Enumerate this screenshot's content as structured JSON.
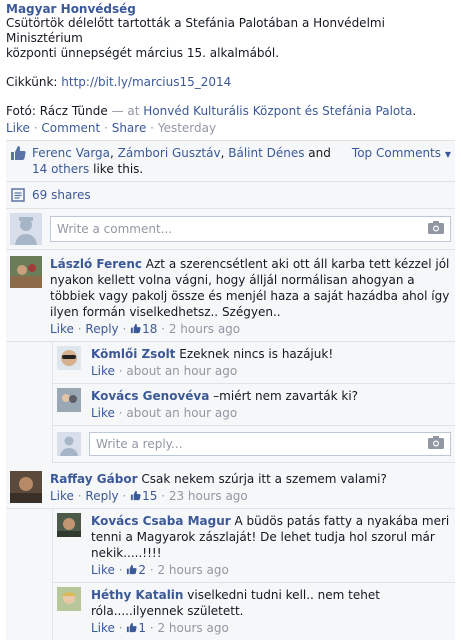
{
  "post": {
    "author": "Magyar Honvédség",
    "line1": "Csütörtök délelőtt tartották a Stefánia Palotában a Honvédelmi Minisztérium",
    "line2": "központi ünnepségét március 15. alkalmából.",
    "cikk_label": "Cikkünk: ",
    "cikk_link": "http://bit.ly/marcius15_2014",
    "foto_label": "Fotó: Rácz Tünde",
    "at_label": " — at ",
    "place": "Honvéd Kulturális Központ és Stefánia Palota",
    "period": ".",
    "like_label": "Like",
    "comment_label": "Comment",
    "share_label": "Share",
    "time": "Yesterday"
  },
  "likes": {
    "names": [
      "Ferenc Varga",
      "Zámbori Gusztáv",
      "Bálint Dénes"
    ],
    "and_text": " and",
    "others": "14 others",
    "suffix": " like this.",
    "top_comments": "Top Comments",
    "shares": "69 shares"
  },
  "composer": {
    "placeholder": "Write a comment...",
    "reply_placeholder": "Write a reply..."
  },
  "comments": [
    {
      "name": "László Ferenc",
      "text": "Azt a szerencsétlent aki ott áll karba tett kézzel jól nyakon kellett volna vágni, hogy álljál normálisan ahogyan a többiek vagy pakolj össze és menjél haza a saját hazádba ahol így ilyen formán viselkedhetsz.. Szégyen..",
      "like": "Like",
      "reply": "Reply",
      "likes": "18",
      "time": "2 hours ago",
      "replies": [
        {
          "name": "Kömlői Zsolt",
          "text": "Ezeknek nincs is hazájuk!",
          "like": "Like",
          "time": "about an hour ago"
        },
        {
          "name": "Kovács Genovéva",
          "text": "–miért nem zavarták ki?",
          "like": "Like",
          "time": "about an hour ago"
        }
      ]
    },
    {
      "name": "Raffay Gábor",
      "text": "Csak nekem szúrja itt a szemem valami?",
      "like": "Like",
      "reply": "Reply",
      "likes": "15",
      "time": "23 hours ago",
      "replies": [
        {
          "name": "Kovács Csaba Magur",
          "text": "A büdös patás fatty a nyakába meri tenni a Magyarok zászlaját! De lehet tudja hol szorul már nekik.....!!!!",
          "like": "Like",
          "likes": "2",
          "time": "2 hours ago"
        },
        {
          "name": "Héthy Katalin",
          "text": "viselkedni tudni kell.. nem tehet róla.....ilyennek született.",
          "like": "Like",
          "likes": "1",
          "time": "2 hours ago"
        }
      ]
    }
  ],
  "colors": {
    "link": "#3b5998",
    "meta": "#9197a3",
    "ufi_bg": "#f6f7f8",
    "border": "#e1e2e3"
  }
}
